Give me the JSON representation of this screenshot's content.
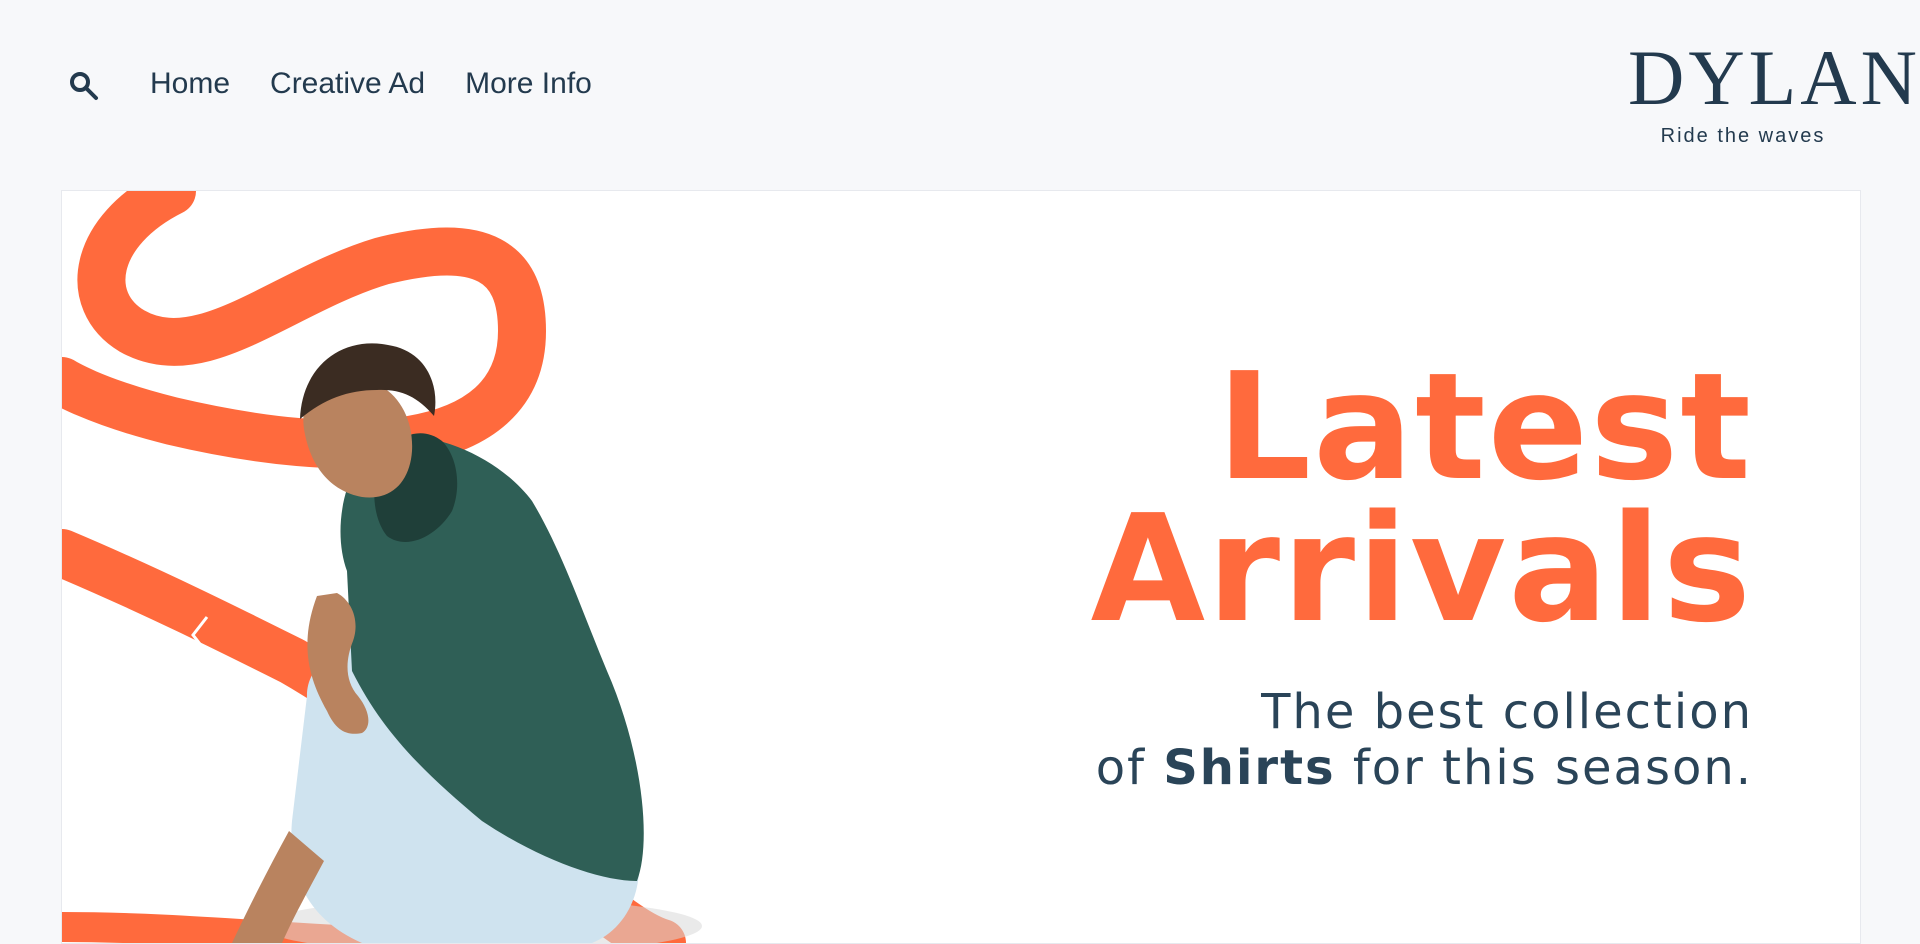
{
  "nav": {
    "items": [
      "Home",
      "Creative Ad",
      "More Info"
    ]
  },
  "brand": {
    "name": "DYLAN",
    "tagline": "Ride the waves"
  },
  "hero": {
    "title_line1": "Latest",
    "title_line2": "Arrivals",
    "subtitle_line1": "The best collection",
    "subtitle_line2_prefix": "of",
    "subtitle_line2_bold": "Shirts",
    "subtitle_line2_suffix": "for this season."
  },
  "colors": {
    "accent": "#ff6a3d",
    "text": "#233a4e",
    "shirt": "#2f5f56",
    "jeans": "#cfe3ef"
  },
  "icons": {
    "search": "search-icon",
    "prev": "chevron-left-icon"
  }
}
